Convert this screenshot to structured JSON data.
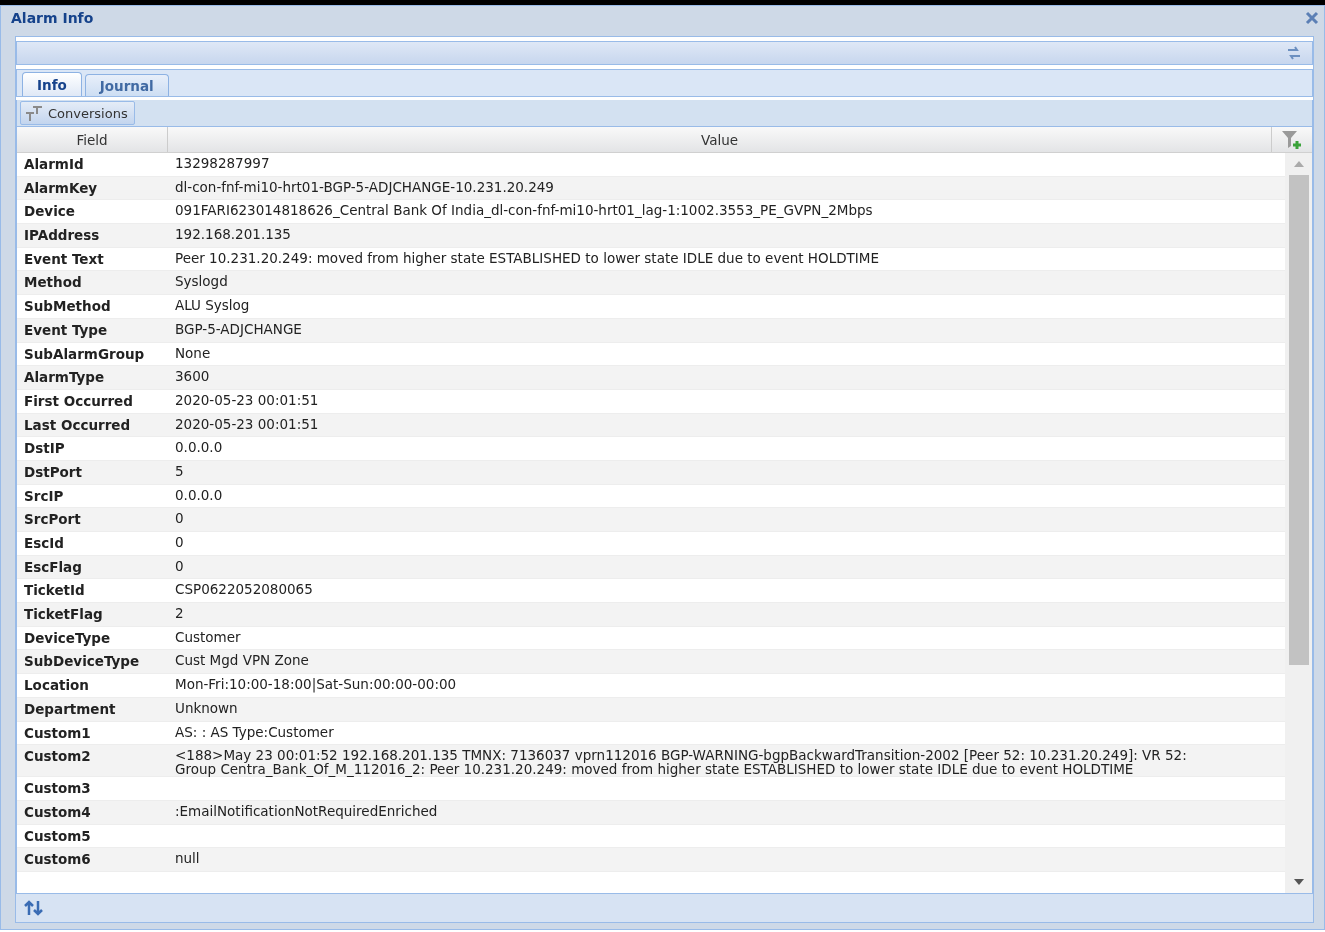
{
  "window": {
    "title": "Alarm Info"
  },
  "tabs": [
    {
      "label": "Info",
      "selected": true
    },
    {
      "label": "Journal",
      "selected": false
    }
  ],
  "toolbar": {
    "button": "Conversions"
  },
  "table": {
    "columns": [
      "Field",
      "Value"
    ],
    "rows": [
      {
        "field": "AlarmId",
        "value": "13298287997"
      },
      {
        "field": "AlarmKey",
        "value": "dl-con-fnf-mi10-hrt01-BGP-5-ADJCHANGE-10.231.20.249"
      },
      {
        "field": "Device",
        "value": "091FARI623014818626_Central Bank Of India_dl-con-fnf-mi10-hrt01_lag-1:1002.3553_PE_GVPN_2Mbps"
      },
      {
        "field": "IPAddress",
        "value": "192.168.201.135"
      },
      {
        "field": "Event Text",
        "value": "Peer 10.231.20.249: moved from higher state ESTABLISHED to lower state IDLE due to event HOLDTIME"
      },
      {
        "field": "Method",
        "value": "Syslogd"
      },
      {
        "field": "SubMethod",
        "value": "ALU Syslog"
      },
      {
        "field": "Event Type",
        "value": "BGP-5-ADJCHANGE"
      },
      {
        "field": "SubAlarmGroup",
        "value": "None"
      },
      {
        "field": "AlarmType",
        "value": "3600"
      },
      {
        "field": "First Occurred",
        "value": "2020-05-23 00:01:51"
      },
      {
        "field": "Last Occurred",
        "value": "2020-05-23 00:01:51"
      },
      {
        "field": "DstIP",
        "value": "0.0.0.0"
      },
      {
        "field": "DstPort",
        "value": "5"
      },
      {
        "field": "SrcIP",
        "value": "0.0.0.0"
      },
      {
        "field": "SrcPort",
        "value": "0"
      },
      {
        "field": "EscId",
        "value": "0"
      },
      {
        "field": "EscFlag",
        "value": "0"
      },
      {
        "field": "TicketId",
        "value": "CSP0622052080065"
      },
      {
        "field": "TicketFlag",
        "value": "2"
      },
      {
        "field": "DeviceType",
        "value": "Customer"
      },
      {
        "field": "SubDeviceType",
        "value": "Cust Mgd VPN Zone"
      },
      {
        "field": "Location",
        "value": "Mon-Fri:10:00-18:00|Sat-Sun:00:00-00:00"
      },
      {
        "field": "Department",
        "value": "Unknown"
      },
      {
        "field": "Custom1",
        "value": "AS: : AS Type:Customer"
      },
      {
        "field": "Custom2",
        "value": "<188>May 23 00:01:52 192.168.201.135 TMNX: 7136037 vprn112016 BGP-WARNING-bgpBackwardTransition-2002 [Peer 52: 10.231.20.249]: VR 52: Group Centra_Bank_Of_M_112016_2: Peer 10.231.20.249: moved from higher state ESTABLISHED to lower state IDLE due to event HOLDTIME"
      },
      {
        "field": "Custom3"
      },
      {
        "field": "Custom4",
        "value": ":EmailNotificationNotRequiredEnriched"
      },
      {
        "field": "Custom5"
      },
      {
        "field": "Custom6",
        "value": "null"
      }
    ]
  }
}
